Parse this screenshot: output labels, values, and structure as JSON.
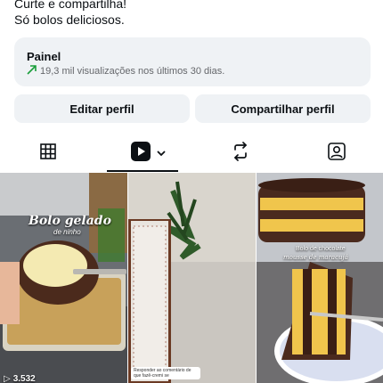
{
  "bio": {
    "line1": "Curte e compartilha!",
    "line2": "Só bolos deliciosos."
  },
  "panel": {
    "title": "Painel",
    "subtitle": "19,3 mil visualizações nos últimos 30 dias.",
    "trend_icon": "trend-up-arrow-icon"
  },
  "buttons": {
    "edit_profile": "Editar perfil",
    "share_profile": "Compartilhar perfil"
  },
  "tabs": [
    {
      "name": "grid",
      "icon": "grid-icon"
    },
    {
      "name": "reels",
      "icon": "reels-play-icon",
      "selected": true
    },
    {
      "name": "reposts",
      "icon": "repost-icon"
    },
    {
      "name": "tagged",
      "icon": "tagged-user-icon"
    }
  ],
  "posts": [
    {
      "overlay_title": "Bolo gelado",
      "overlay_sub": "de ninho",
      "count": "3.532"
    },
    {
      "overlay_note": "Responder ao comentário de",
      "overlay_note2": "que fazê-cremi se"
    },
    {
      "overlay_title": "Bolo de chocolate",
      "overlay_sub": "mousse de maracujá"
    }
  ],
  "colors": {
    "panel_bg": "#eff2f5",
    "trend_green": "#1a9e3b",
    "text": "#0c1014"
  }
}
